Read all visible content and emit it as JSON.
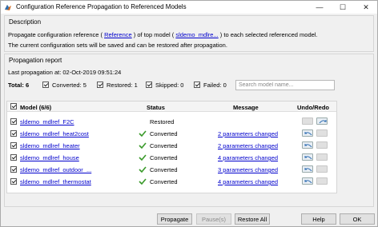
{
  "window": {
    "title": "Configuration Reference Propagation to Referenced Models",
    "minimize_glyph": "—",
    "maximize_glyph": "☐",
    "close_glyph": "✕"
  },
  "description": {
    "title": "Description",
    "line1_pre": "Propagate configuration reference (",
    "reference_link": "Reference",
    "line1_mid": ") of top model (",
    "model_link": "sldemo_mdlre...",
    "line1_post": ") to each selected referenced model.",
    "line2": "The current configuration sets will be saved and can be restored after propagation."
  },
  "report": {
    "title": "Propagation report",
    "last_propagation": "Last propagation at:  02-Oct-2019 09:51:24",
    "total": "Total: 6",
    "converted": "Converted: 5",
    "restored": "Restored: 1",
    "skipped": "Skipped: 0",
    "failed": "Failed: 0",
    "search_placeholder": "Search model name..."
  },
  "table": {
    "headers": {
      "model": "Model (6/6)",
      "status": "Status",
      "message": "Message",
      "undo": "Undo/Redo"
    },
    "rows": [
      {
        "model": "sldemo_mdlref_F2C",
        "status": "Restored",
        "message": "",
        "undo_enabled": false,
        "redo_enabled": true
      },
      {
        "model": "sldemo_mdlref_heat2cost",
        "status": "Converted",
        "message": "2 parameters changed",
        "undo_enabled": true,
        "redo_enabled": false
      },
      {
        "model": "sldemo_mdlref_heater",
        "status": "Converted",
        "message": "2 parameters changed",
        "undo_enabled": true,
        "redo_enabled": false
      },
      {
        "model": "sldemo_mdlref_house",
        "status": "Converted",
        "message": "4 parameters changed",
        "undo_enabled": true,
        "redo_enabled": false
      },
      {
        "model": "sldemo_mdlref_outdoor_...",
        "status": "Converted",
        "message": "3 parameters changed",
        "undo_enabled": true,
        "redo_enabled": false
      },
      {
        "model": "sldemo_mdlref_thermostat",
        "status": "Converted",
        "message": "4 parameters changed",
        "undo_enabled": true,
        "redo_enabled": false
      }
    ]
  },
  "buttons": {
    "propagate": "Propagate",
    "pause": "Pause(s)",
    "restore_all": "Restore All",
    "help": "Help",
    "ok": "OK"
  },
  "colors": {
    "link": "#0000cc",
    "converted_check": "#3a9a2a"
  }
}
